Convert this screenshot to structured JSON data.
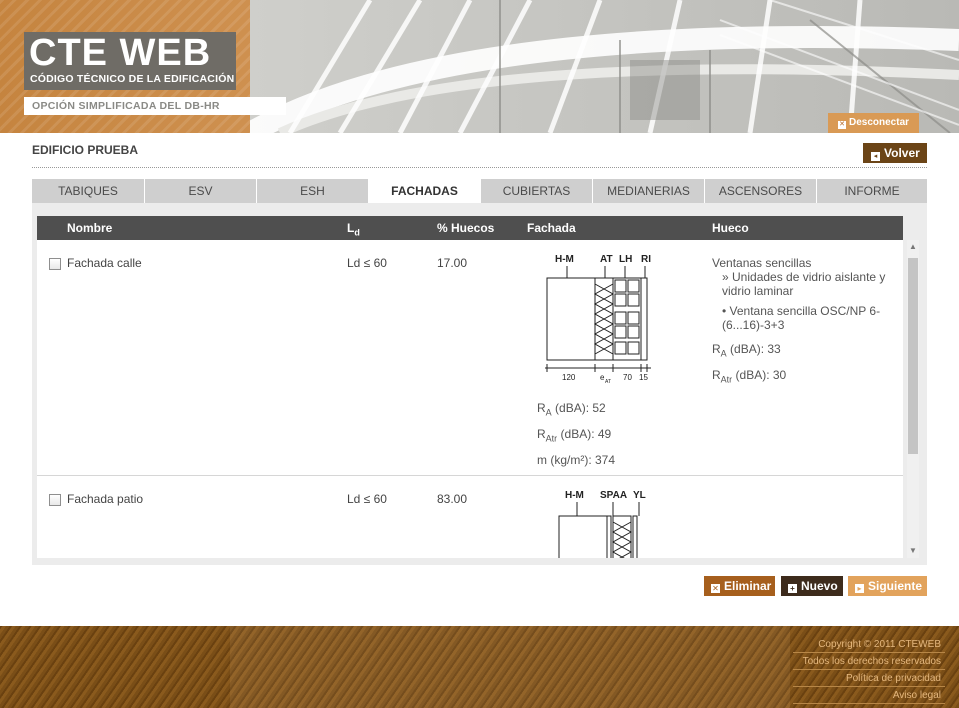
{
  "header": {
    "title": "CTE WEB",
    "subtitle": "CÓDIGO TÉCNICO DE LA EDIFICACIÓN",
    "tagline": "OPCIÓN SIMPLIFICADA DEL DB-HR",
    "disconnect_label": "Desconectar"
  },
  "project": {
    "name": "EDIFICIO PRUEBA",
    "back_label": "Volver"
  },
  "tabs": [
    {
      "label": "TABIQUES"
    },
    {
      "label": "ESV"
    },
    {
      "label": "ESH"
    },
    {
      "label": "FACHADAS",
      "active": true
    },
    {
      "label": "CUBIERTAS"
    },
    {
      "label": "MEDIANERIAS"
    },
    {
      "label": "ASCENSORES"
    },
    {
      "label": "INFORME"
    }
  ],
  "table": {
    "headers": {
      "nombre": "Nombre",
      "ld_main": "L",
      "ld_sub": "d",
      "huecos": "% Huecos",
      "fachada": "Fachada",
      "hueco": "Hueco"
    },
    "rows": [
      {
        "name": "Fachada calle",
        "ld": "Ld ≤ 60",
        "huecos": "17.00",
        "diagram": {
          "labels_top": [
            "H-M",
            "AT",
            "LH",
            "RI"
          ],
          "labels_bottom": [
            "120",
            "e",
            "AT",
            "70",
            "15"
          ]
        },
        "ra_label": "R",
        "ra_sub": "A",
        "ra_unit": " (dBA): ",
        "ra_value": "52",
        "ratr_label": "R",
        "ratr_sub": "Atr",
        "ratr_unit": " (dBA): ",
        "ratr_value": "49",
        "m_label": "m (kg/m²): ",
        "m_value": "374",
        "hueco": {
          "type": "Ventanas sencillas",
          "subtype": "» Unidades de vidrio aislante y vidrio laminar",
          "product": "• Ventana sencilla OSC/NP 6-(6...16)-3+3",
          "ra_label": "R",
          "ra_sub": "A",
          "ra_unit": " (dBA): ",
          "ra_value": "33",
          "ratr_label": "R",
          "ratr_sub": "Atr",
          "ratr_unit": " (dBA): ",
          "ratr_value": "30"
        }
      },
      {
        "name": "Fachada patio",
        "ld": "Ld ≤ 60",
        "huecos": "83.00",
        "diagram": {
          "labels_top": [
            "H-M",
            "SPAA",
            "YL"
          ]
        }
      }
    ]
  },
  "actions": {
    "delete_label": "Eliminar",
    "new_label": "Nuevo",
    "next_label": "Siguiente"
  },
  "footer": {
    "links": [
      "Copyright © 2011 CTEWEB",
      "Todos los derechos reservados",
      "Política de privacidad",
      "Aviso legal"
    ]
  },
  "colors": {
    "brand_orange": "#cf9150",
    "header_gray": "#6f6c66",
    "table_header": "#4f4f4f",
    "delete_button": "#a65f1d",
    "new_button": "#3d2b1c",
    "next_button": "#e2a35c",
    "back_button": "#6b4416",
    "footer_brown": "#7a4e17"
  },
  "icons": [
    "close-icon",
    "back-icon",
    "delete-icon",
    "plus-icon",
    "next-icon",
    "checkbox-icon"
  ]
}
